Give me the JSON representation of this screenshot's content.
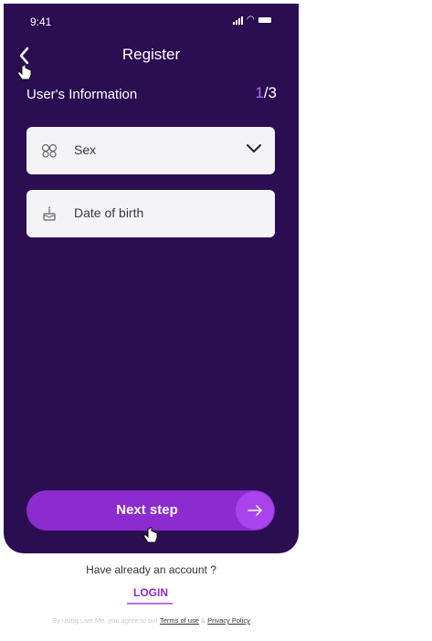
{
  "status_bar": {
    "time": "9:41"
  },
  "header": {
    "title": "Register"
  },
  "section": {
    "title": "User's Information",
    "step_current": "1",
    "step_total": "/3"
  },
  "fields": {
    "sex": {
      "label": "Sex",
      "icon": "gender-icon"
    },
    "dob": {
      "label": "Date of birth",
      "icon": "cake-icon"
    }
  },
  "actions": {
    "next_label": "Next step"
  },
  "footer": {
    "have_account": "Have already an account ?",
    "login_label": "LOGIN",
    "terms_prefix": "By using Live Me, you agree to our",
    "terms_link": "Terms of use",
    "terms_and": "&",
    "privacy_link": "Privacy Policy"
  },
  "colors": {
    "panel_bg": "#2b0d52",
    "accent": "#8b2bd0",
    "accent_light": "#a944ec",
    "field_bg": "#f4f4f8"
  }
}
